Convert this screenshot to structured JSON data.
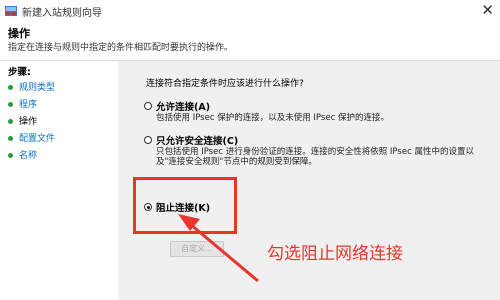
{
  "window": {
    "title": "新建入站规则向导",
    "close_glyph": "✕"
  },
  "header": {
    "title": "操作",
    "description": "指定在连接与规则中指定的条件相匹配时要执行的操作。"
  },
  "sidebar": {
    "steps_title": "步骤:",
    "items": [
      {
        "label": "规则类型",
        "active": false
      },
      {
        "label": "程序",
        "active": false
      },
      {
        "label": "操作",
        "active": true
      },
      {
        "label": "配置文件",
        "active": false
      },
      {
        "label": "名称",
        "active": false
      }
    ]
  },
  "main": {
    "prompt": "连接符合指定条件时应该进行什么操作?",
    "options": [
      {
        "label": "允许连接(A)",
        "desc": "包括使用 IPsec 保护的连接，以及未使用 IPsec 保护的连接。",
        "checked": false
      },
      {
        "label": "只允许安全连接(C)",
        "desc": "只包括使用 IPsec 进行身份验证的连接。连接的安全性将依照 IPsec 属性中的设置以及\"连接安全规则\"节点中的规则受到保障。",
        "checked": false
      },
      {
        "label": "阻止连接(K)",
        "desc": "",
        "checked": true
      }
    ],
    "custom_button": "自定义..."
  },
  "annotation": {
    "text": "勾选阻止网络连接",
    "color": "#e8362c"
  }
}
